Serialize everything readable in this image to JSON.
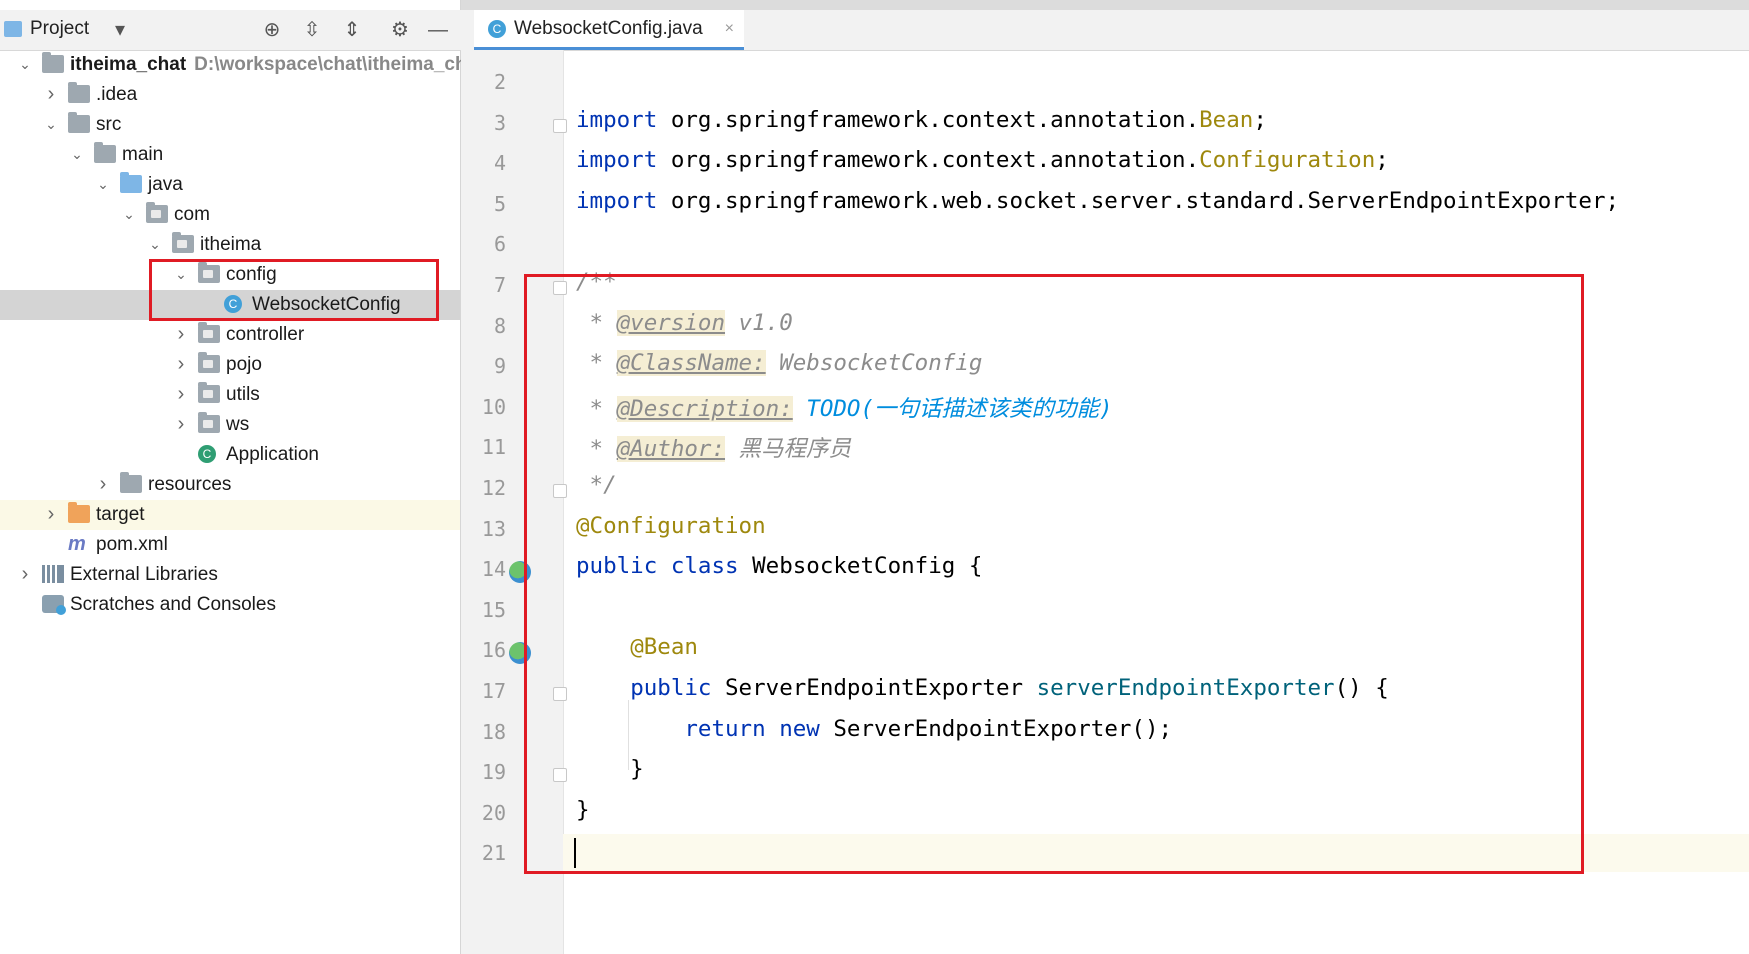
{
  "project_panel": {
    "title": "Project",
    "icons": [
      "locate-icon",
      "expand-all-icon",
      "collapse-all-icon",
      "gear-icon",
      "minimize-icon"
    ]
  },
  "tree": [
    {
      "label": "itheima_chat",
      "extra": "D:\\workspace\\chat\\itheima_chat",
      "depth": 0,
      "expanded": true,
      "icon": "module-folder",
      "bold": true
    },
    {
      "label": ".idea",
      "depth": 1,
      "expanded": false,
      "icon": "folder"
    },
    {
      "label": "src",
      "depth": 1,
      "expanded": true,
      "icon": "folder"
    },
    {
      "label": "main",
      "depth": 2,
      "expanded": true,
      "icon": "folder"
    },
    {
      "label": "java",
      "depth": 3,
      "expanded": true,
      "icon": "source-folder"
    },
    {
      "label": "com",
      "depth": 4,
      "expanded": true,
      "icon": "package"
    },
    {
      "label": "itheima",
      "depth": 5,
      "expanded": true,
      "icon": "package"
    },
    {
      "label": "config",
      "depth": 6,
      "expanded": true,
      "icon": "package"
    },
    {
      "label": "WebsocketConfig",
      "depth": 7,
      "icon": "class",
      "selected": true
    },
    {
      "label": "controller",
      "depth": 6,
      "expanded": false,
      "icon": "package"
    },
    {
      "label": "pojo",
      "depth": 6,
      "expanded": false,
      "icon": "package"
    },
    {
      "label": "utils",
      "depth": 6,
      "expanded": false,
      "icon": "package"
    },
    {
      "label": "ws",
      "depth": 6,
      "expanded": false,
      "icon": "package"
    },
    {
      "label": "Application",
      "depth": 6,
      "icon": "spring-app"
    },
    {
      "label": "resources",
      "depth": 3,
      "expanded": false,
      "icon": "resources-folder"
    },
    {
      "label": "target",
      "depth": 1,
      "expanded": false,
      "icon": "excluded-folder"
    },
    {
      "label": "pom.xml",
      "depth": 1,
      "icon": "maven"
    },
    {
      "label": "External Libraries",
      "depth": 0,
      "expanded": false,
      "icon": "libraries"
    },
    {
      "label": "Scratches and Consoles",
      "depth": 0,
      "icon": "scratches"
    }
  ],
  "editor": {
    "tab": {
      "label": "WebsocketConfig.java",
      "close": "×"
    },
    "lines": [
      {
        "n": "2",
        "segs": []
      },
      {
        "n": "3",
        "segs": [
          {
            "t": "import ",
            "c": "kw"
          },
          {
            "t": "org.springframework.context.annotation."
          },
          {
            "t": "Bean",
            "c": "ann"
          },
          {
            "t": ";"
          }
        ]
      },
      {
        "n": "4",
        "segs": [
          {
            "t": "import ",
            "c": "kw"
          },
          {
            "t": "org.springframework.context.annotation."
          },
          {
            "t": "Configuration",
            "c": "ann"
          },
          {
            "t": ";"
          }
        ]
      },
      {
        "n": "5",
        "segs": [
          {
            "t": "import ",
            "c": "kw"
          },
          {
            "t": "org.springframework.web.socket.server.standard.ServerEndpointExporter;"
          }
        ]
      },
      {
        "n": "6",
        "segs": []
      },
      {
        "n": "7",
        "segs": [
          {
            "t": "/**",
            "c": "cm"
          }
        ]
      },
      {
        "n": "8",
        "segs": [
          {
            "t": " * ",
            "c": "cm"
          },
          {
            "t": "@version",
            "c": "tag"
          },
          {
            "t": " v1.0",
            "c": "cm"
          }
        ]
      },
      {
        "n": "9",
        "segs": [
          {
            "t": " * ",
            "c": "cm"
          },
          {
            "t": "@ClassName:",
            "c": "tag"
          },
          {
            "t": " WebsocketConfig",
            "c": "cm"
          }
        ]
      },
      {
        "n": "10",
        "segs": [
          {
            "t": " * ",
            "c": "cm"
          },
          {
            "t": "@Description:",
            "c": "tag"
          },
          {
            "t": " TODO(一句话描述该类的功能)",
            "c": "todo"
          }
        ]
      },
      {
        "n": "11",
        "segs": [
          {
            "t": " * ",
            "c": "cm"
          },
          {
            "t": "@Author:",
            "c": "tag"
          },
          {
            "t": " 黑马程序员",
            "c": "cm"
          }
        ]
      },
      {
        "n": "12",
        "segs": [
          {
            "t": " */",
            "c": "cm"
          }
        ]
      },
      {
        "n": "13",
        "segs": [
          {
            "t": "@Configuration",
            "c": "ann"
          }
        ]
      },
      {
        "n": "14",
        "segs": [
          {
            "t": "public class ",
            "c": "kw"
          },
          {
            "t": "WebsocketConfig {"
          }
        ]
      },
      {
        "n": "15",
        "segs": []
      },
      {
        "n": "16",
        "segs": [
          {
            "t": "    "
          },
          {
            "t": "@Bean",
            "c": "ann"
          }
        ]
      },
      {
        "n": "17",
        "segs": [
          {
            "t": "    "
          },
          {
            "t": "public ",
            "c": "kw"
          },
          {
            "t": "ServerEndpointExporter "
          },
          {
            "t": "serverEndpointExporter",
            "c": "fn"
          },
          {
            "t": "() {"
          }
        ]
      },
      {
        "n": "18",
        "segs": [
          {
            "t": "        "
          },
          {
            "t": "return new ",
            "c": "kw"
          },
          {
            "t": "ServerEndpointExporter();"
          }
        ]
      },
      {
        "n": "19",
        "segs": [
          {
            "t": "    }"
          }
        ]
      },
      {
        "n": "20",
        "segs": [
          {
            "t": "}"
          }
        ]
      },
      {
        "n": "21",
        "segs": []
      }
    ]
  },
  "colors": {
    "highlight": "#e01b24",
    "keyword": "#0033b3",
    "annotation": "#9e880d",
    "selection": "#d4d4d4"
  }
}
